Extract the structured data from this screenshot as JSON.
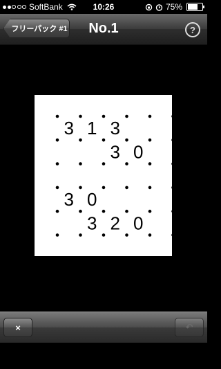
{
  "status_bar": {
    "carrier": "SoftBank",
    "time": "10:26",
    "battery": "75%",
    "battery_level": 0.75
  },
  "nav": {
    "back_label": "フリーパック #1",
    "title": "No.1",
    "help_label": "?"
  },
  "puzzle": {
    "rows": 6,
    "cols": 6,
    "clues": [
      [
        "3",
        "1",
        "3",
        "",
        "",
        ""
      ],
      [
        "",
        "",
        "3",
        "0",
        "",
        ""
      ],
      [
        "",
        "",
        "",
        "",
        "",
        ""
      ],
      [
        "3",
        "0",
        "",
        "",
        "",
        ""
      ],
      [
        "",
        "3",
        "2",
        "0",
        "",
        ""
      ],
      [
        "",
        "",
        "",
        "",
        "",
        ""
      ]
    ]
  },
  "toolbar": {
    "close_label": "×",
    "undo_label": "↶"
  }
}
